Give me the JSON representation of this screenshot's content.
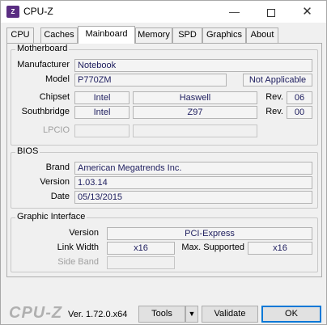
{
  "window": {
    "title": "CPU-Z",
    "icon": "cpu-z-app-icon",
    "min_glyph": "—",
    "close_glyph": "✕"
  },
  "tabs": [
    {
      "label": "CPU"
    },
    {
      "label": "Caches"
    },
    {
      "label": "Mainboard",
      "active": true
    },
    {
      "label": "Memory"
    },
    {
      "label": "SPD"
    },
    {
      "label": "Graphics"
    },
    {
      "label": "About"
    }
  ],
  "motherboard": {
    "legend": "Motherboard",
    "manufacturer_label": "Manufacturer",
    "manufacturer": "Notebook",
    "model_label": "Model",
    "model": "P770ZM",
    "model_rev": "Not Applicable",
    "chipset_label": "Chipset",
    "chipset_vendor": "Intel",
    "chipset_name": "Haswell",
    "chipset_rev_label": "Rev.",
    "chipset_rev": "06",
    "southbridge_label": "Southbridge",
    "southbridge_vendor": "Intel",
    "southbridge_name": "Z97",
    "southbridge_rev_label": "Rev.",
    "southbridge_rev": "00",
    "lpcio_label": "LPCIO"
  },
  "bios": {
    "legend": "BIOS",
    "brand_label": "Brand",
    "brand": "American Megatrends Inc.",
    "version_label": "Version",
    "version": "1.03.14",
    "date_label": "Date",
    "date": "05/13/2015"
  },
  "graphic_interface": {
    "legend": "Graphic Interface",
    "version_label": "Version",
    "version": "PCI-Express",
    "link_width_label": "Link Width",
    "link_width": "x16",
    "max_supported_label": "Max. Supported",
    "max_supported": "x16",
    "side_band_label": "Side Band"
  },
  "footer": {
    "logo": "CPU-Z",
    "version": "Ver. 1.72.0.x64",
    "tools_label": "Tools",
    "tools_arrow": "▼",
    "validate_label": "Validate",
    "ok_label": "OK"
  }
}
